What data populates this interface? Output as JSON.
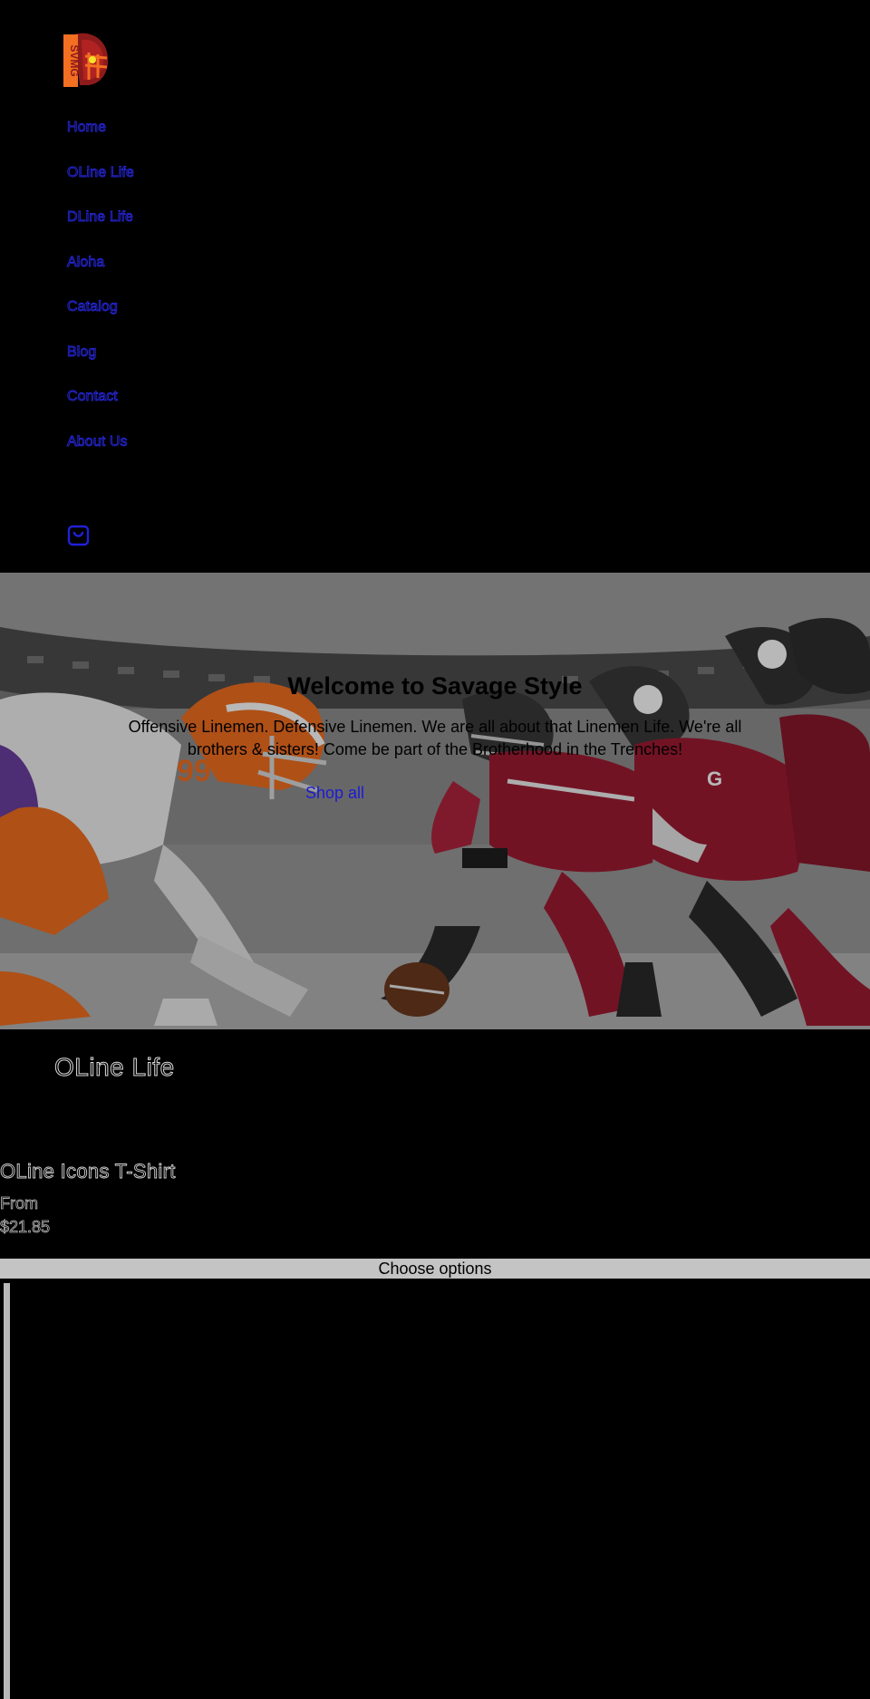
{
  "header": {
    "logo_text": "SVMG",
    "nav": [
      {
        "label": "Home"
      },
      {
        "label": "OLine Life"
      },
      {
        "label": "DLine Life"
      },
      {
        "label": "Aloha"
      },
      {
        "label": "Catalog"
      },
      {
        "label": "Blog"
      },
      {
        "label": "Contact"
      },
      {
        "label": "About Us"
      }
    ],
    "cart_icon": "cart-bag-icon"
  },
  "hero": {
    "title": "Welcome to Savage Style",
    "text": "Offensive Linemen. Defensive Linemen. We are all about that Linemen Life. We're all brothers & sisters! Come be part of the Brotherhood in the Trenches!",
    "link_label": "Shop all",
    "colors": {
      "orange_team": "#f36f21",
      "red_team": "#9e1b32",
      "helmet_dark": "#2b2b2b"
    }
  },
  "collection": {
    "title": "OLine Life",
    "product": {
      "title": "OLine Icons T-Shirt",
      "price_prefix": "From",
      "price": "$21.85",
      "button_label": "Choose options"
    }
  },
  "colors": {
    "background": "#000000",
    "link": "#2626d9",
    "button_bg": "#c4c4c4"
  }
}
